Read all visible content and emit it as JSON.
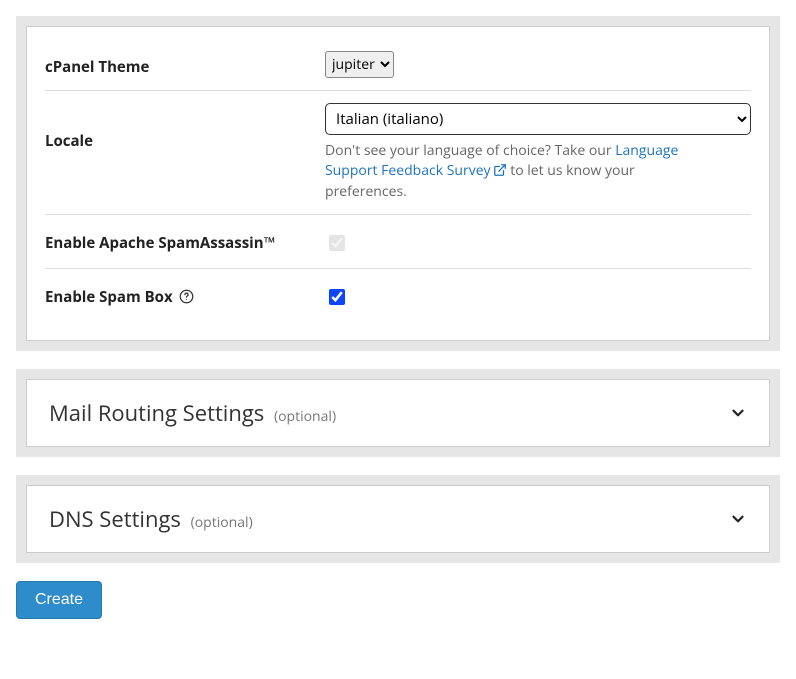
{
  "form": {
    "theme": {
      "label": "cPanel Theme",
      "value": "jupiter"
    },
    "locale": {
      "label": "Locale",
      "value": "Italian (italiano)",
      "hint_prefix": "Don't see your language of choice? Take our ",
      "hint_link": "Language Support Feedback Survey",
      "hint_suffix": " to let us know your preferences."
    },
    "spamassassin": {
      "label": "Enable Apache SpamAssassin™",
      "checked": true,
      "disabled": true
    },
    "spambox": {
      "label": "Enable Spam Box",
      "checked": true
    }
  },
  "accordions": {
    "mail": {
      "title": "Mail Routing Settings",
      "optional": "(optional)"
    },
    "dns": {
      "title": "DNS Settings",
      "optional": "(optional)"
    }
  },
  "actions": {
    "create": "Create"
  }
}
